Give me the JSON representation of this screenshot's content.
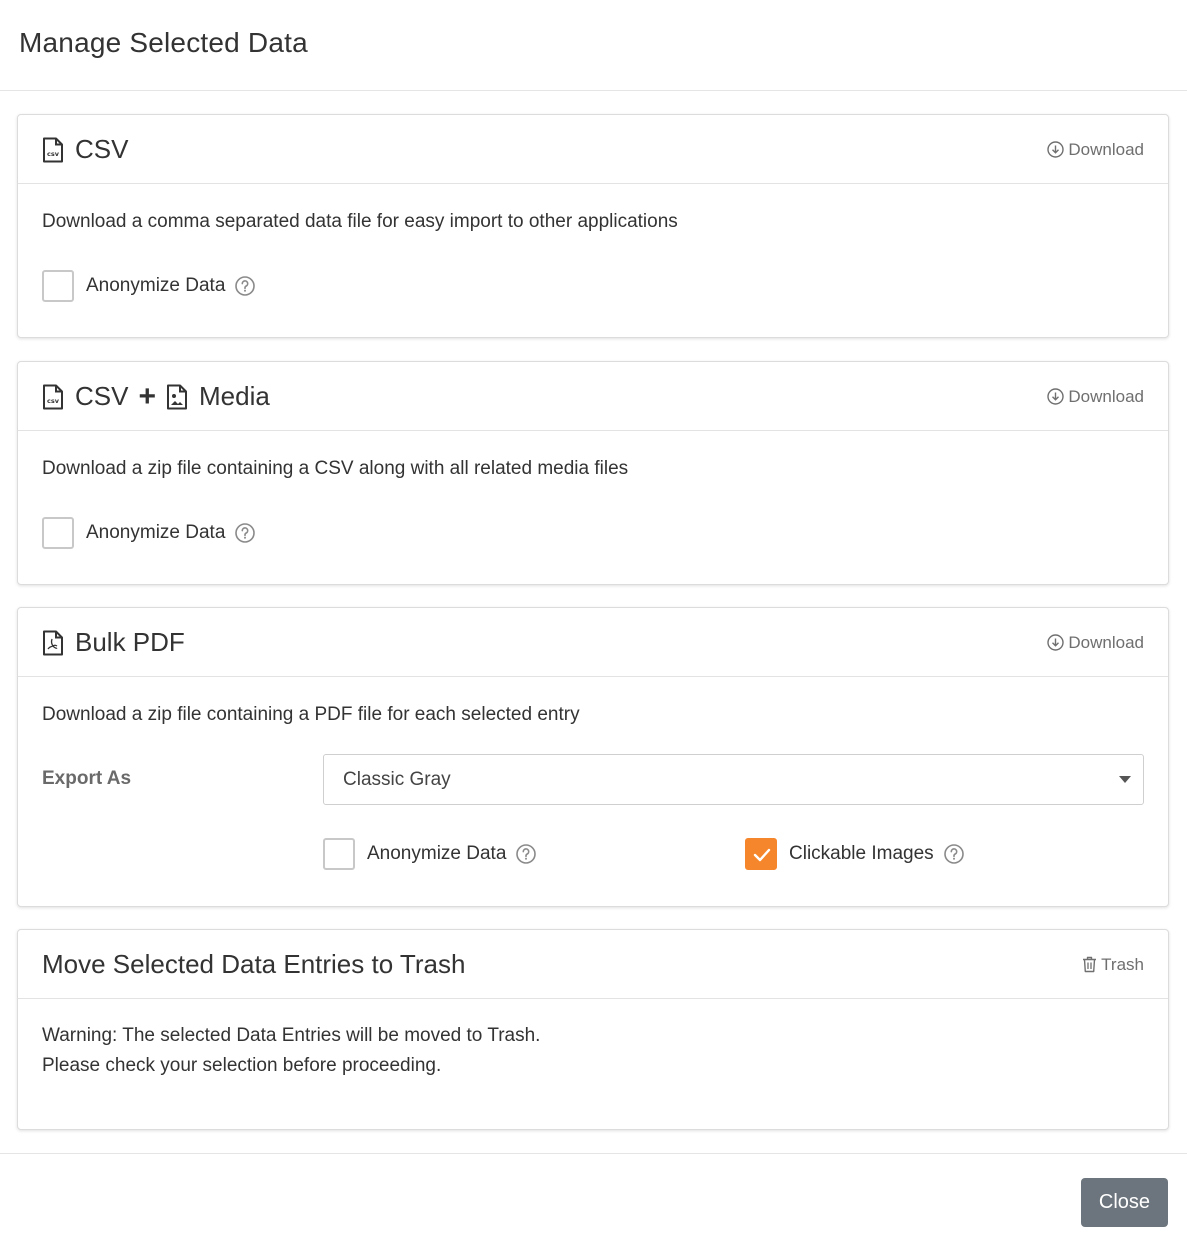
{
  "modal": {
    "title": "Manage Selected Data",
    "close_label": "Close"
  },
  "csv": {
    "icon": "csv-file-icon",
    "title": "CSV",
    "action_label": "Download",
    "description": "Download a comma separated data file for easy import to other applications",
    "anonymize_label": "Anonymize Data",
    "anonymize_checked": false
  },
  "csv_media": {
    "icon": "csv-file-icon",
    "plus": "+",
    "media_icon": "image-file-icon",
    "title_csv": "CSV",
    "title_media": "Media",
    "action_label": "Download",
    "description": "Download a zip file containing a CSV along with all related media files",
    "anonymize_label": "Anonymize Data",
    "anonymize_checked": false
  },
  "bulk_pdf": {
    "icon": "pdf-file-icon",
    "title": "Bulk PDF",
    "action_label": "Download",
    "description": "Download a zip file containing a PDF file for each selected entry",
    "export_as_label": "Export As",
    "export_as_value": "Classic Gray",
    "anonymize_label": "Anonymize Data",
    "anonymize_checked": false,
    "clickable_images_label": "Clickable Images",
    "clickable_images_checked": true
  },
  "trash": {
    "title": "Move Selected Data Entries to Trash",
    "action_label": "Trash",
    "warning_line1": "Warning: The selected Data Entries will be moved to Trash.",
    "warning_line2": "Please check your selection before proceeding."
  },
  "colors": {
    "accent": "#f5862b",
    "close_button": "#6c757d"
  }
}
